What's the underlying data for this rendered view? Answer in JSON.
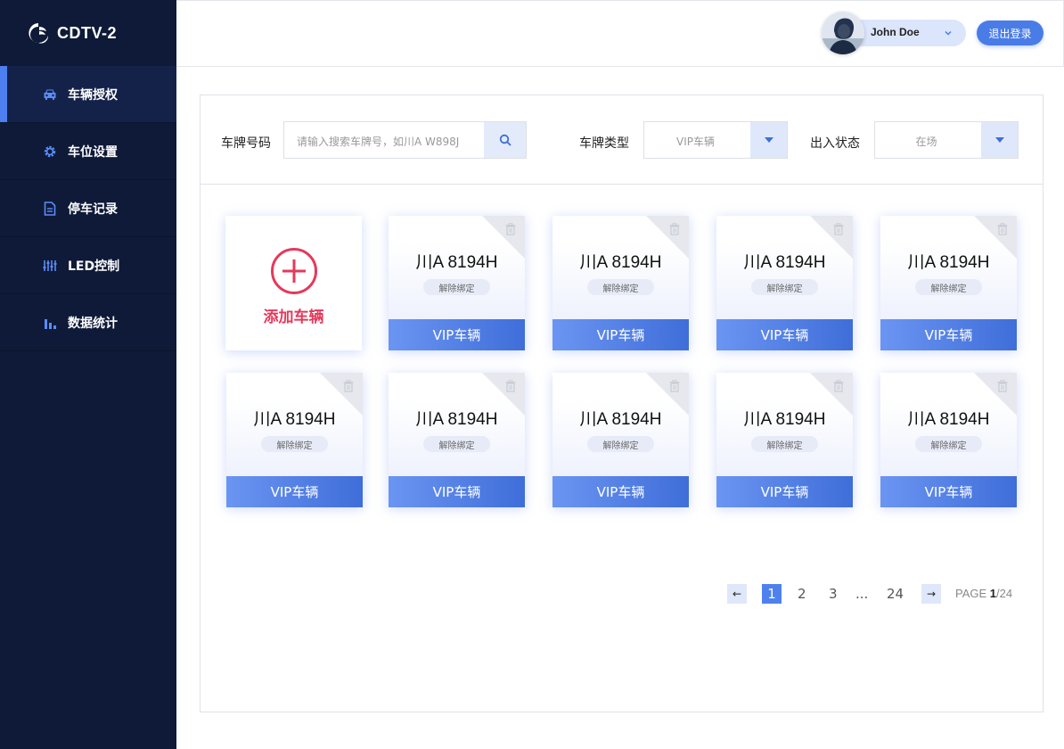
{
  "app": {
    "title": "CDTV-2"
  },
  "sidebar": {
    "items": [
      {
        "label": "车辆授权",
        "icon": "car-icon",
        "active": true
      },
      {
        "label": "车位设置",
        "icon": "gear-icon",
        "active": false
      },
      {
        "label": "停车记录",
        "icon": "document-icon",
        "active": false
      },
      {
        "label": "LED控制",
        "icon": "sliders-icon",
        "active": false
      },
      {
        "label": "数据统计",
        "icon": "bar-chart-icon",
        "active": false
      }
    ]
  },
  "header": {
    "user_name": "John Doe",
    "logout_label": "退出登录"
  },
  "filters": {
    "plate_label": "车牌号码",
    "search_placeholder": "请输入搜索车牌号，如川A  W898J",
    "type_label": "车牌类型",
    "type_value": "VIP车辆",
    "status_label": "出入状态",
    "status_value": "在场"
  },
  "add_card": {
    "label": "添加车辆"
  },
  "cards": [
    {
      "plate": "川A 8194H",
      "unbind": "解除绑定",
      "type": "VIP车辆"
    },
    {
      "plate": "川A 8194H",
      "unbind": "解除绑定",
      "type": "VIP车辆"
    },
    {
      "plate": "川A 8194H",
      "unbind": "解除绑定",
      "type": "VIP车辆"
    },
    {
      "plate": "川A 8194H",
      "unbind": "解除绑定",
      "type": "VIP车辆"
    },
    {
      "plate": "川A 8194H",
      "unbind": "解除绑定",
      "type": "VIP车辆"
    },
    {
      "plate": "川A 8194H",
      "unbind": "解除绑定",
      "type": "VIP车辆"
    },
    {
      "plate": "川A 8194H",
      "unbind": "解除绑定",
      "type": "VIP车辆"
    },
    {
      "plate": "川A 8194H",
      "unbind": "解除绑定",
      "type": "VIP车辆"
    },
    {
      "plate": "川A 8194H",
      "unbind": "解除绑定",
      "type": "VIP车辆"
    }
  ],
  "pagination": {
    "prev": "←",
    "next": "→",
    "pages": [
      "1",
      "2",
      "3",
      "...",
      "24"
    ],
    "current": "1",
    "page_prefix": "PAGE ",
    "page_current": "1",
    "page_total": "/24"
  },
  "colors": {
    "sidebar_bg": "#0f1a38",
    "accent": "#4a7ce8",
    "add_red": "#e5395b"
  }
}
